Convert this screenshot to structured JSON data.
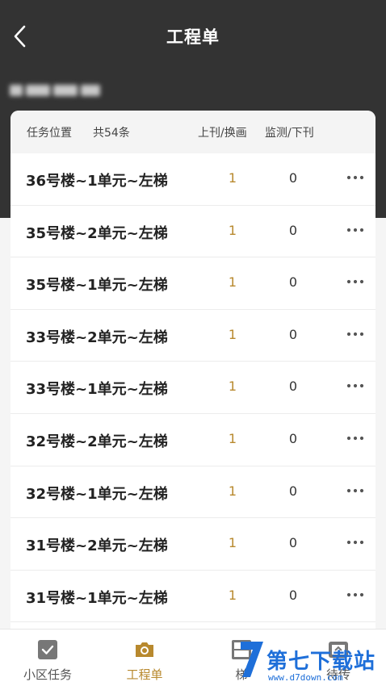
{
  "header": {
    "title": "工程单",
    "blurred_community_name": ""
  },
  "table": {
    "col_position": "任务位置",
    "count_label": "共54条",
    "col_publish": "上刊/换画",
    "col_monitor": "监测/下刊",
    "rows": [
      {
        "name": "36号楼~1单元~左梯",
        "publish": "1",
        "monitor": "0"
      },
      {
        "name": "35号楼~2单元~左梯",
        "publish": "1",
        "monitor": "0"
      },
      {
        "name": "35号楼~1单元~左梯",
        "publish": "1",
        "monitor": "0"
      },
      {
        "name": "33号楼~2单元~左梯",
        "publish": "1",
        "monitor": "0"
      },
      {
        "name": "33号楼~1单元~左梯",
        "publish": "1",
        "monitor": "0"
      },
      {
        "name": "32号楼~2单元~左梯",
        "publish": "1",
        "monitor": "0"
      },
      {
        "name": "32号楼~1单元~左梯",
        "publish": "1",
        "monitor": "0"
      },
      {
        "name": "31号楼~2单元~左梯",
        "publish": "1",
        "monitor": "0"
      },
      {
        "name": "31号楼~1单元~左梯",
        "publish": "1",
        "monitor": "0"
      }
    ]
  },
  "tabbar": {
    "tabs": [
      {
        "label": "小区任务",
        "icon": "clipboard-check-icon"
      },
      {
        "label": "工程单",
        "icon": "camera-icon",
        "active": true
      },
      {
        "label": "梯",
        "icon": "grid-icon"
      },
      {
        "label": "待传",
        "icon": "upload-icon"
      }
    ]
  },
  "watermark": {
    "text": "第七下载站",
    "url": "www.d7down.com"
  },
  "colors": {
    "header_bg": "#333333",
    "accent": "#b8892e",
    "watermark": "#1e6fd9"
  }
}
